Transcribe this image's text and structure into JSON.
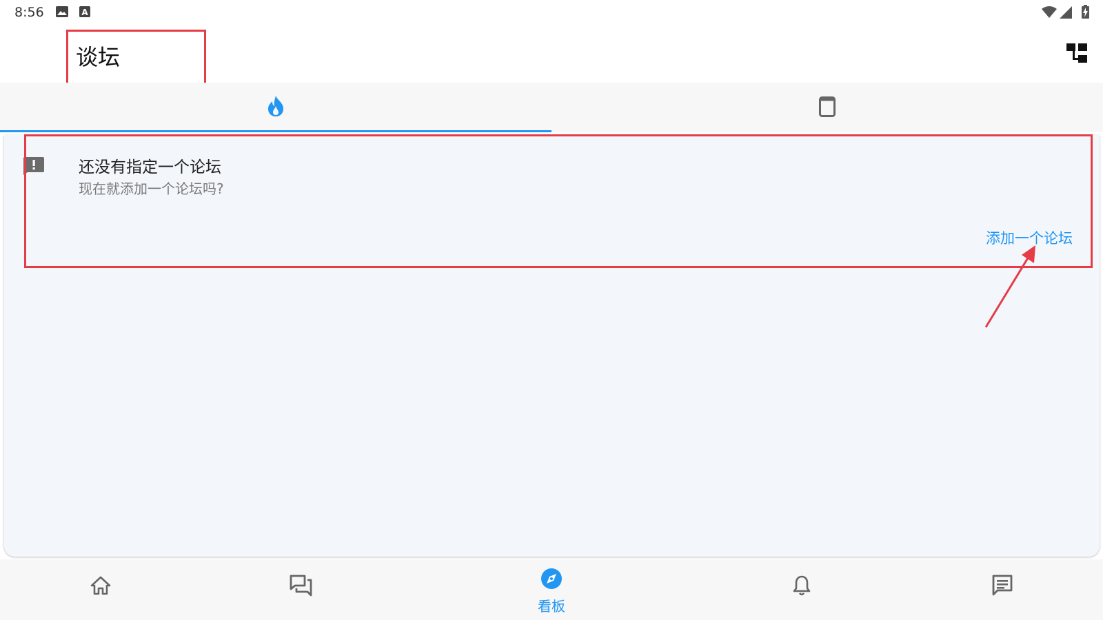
{
  "status_bar": {
    "time": "8:56"
  },
  "app_bar": {
    "title": "谈坛"
  },
  "tabs": [
    {
      "icon": "flame-icon",
      "selected": true
    },
    {
      "icon": "tablet-icon",
      "selected": false
    }
  ],
  "notice": {
    "title": "还没有指定一个论坛",
    "subtitle": "现在就添加一个论坛吗?",
    "action_label": "添加一个论坛"
  },
  "bottom_nav": [
    {
      "icon": "home-icon",
      "label": "",
      "selected": false
    },
    {
      "icon": "forum-icon",
      "label": "",
      "selected": false
    },
    {
      "icon": "compass-icon",
      "label": "看板",
      "selected": true
    },
    {
      "icon": "bell-icon",
      "label": "",
      "selected": false
    },
    {
      "icon": "message-icon",
      "label": "",
      "selected": false
    }
  ],
  "colors": {
    "accent": "#2196f3",
    "annotation": "#e53c45",
    "panel_bg": "#f3f7fc",
    "icon_gray": "#666666"
  }
}
